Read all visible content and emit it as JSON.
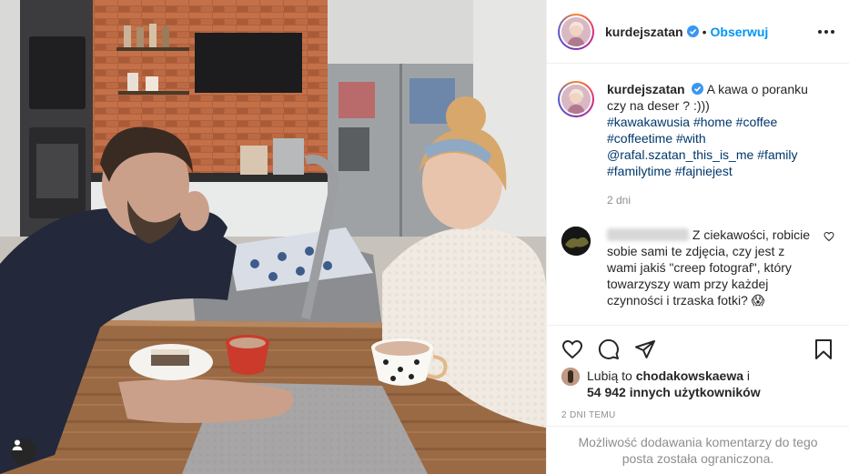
{
  "post": {
    "username": "kurdejszatan",
    "separator": "•",
    "follow_label": "Obserwuj"
  },
  "caption": {
    "username": "kurdejszatan",
    "text": "A kawa o poranku czy na deser ? :)))",
    "hashtags": [
      "#kawakawusia",
      "#home",
      "#coffee",
      "#coffeetime",
      "#with"
    ],
    "mention": "@rafal.szatan_this_is_me",
    "hashtags2": [
      "#family",
      "#familytime",
      "#fajniejest"
    ],
    "time": "2 dni"
  },
  "comment": {
    "text": "Z ciekawości, robicie sobie sami te zdjęcia, czy jest z wami jakiś \"creep fotograf\", który towarzyszy wam przy każdej czynności i trzaska fotki? 😱"
  },
  "likes": {
    "prefix": "Lubią to",
    "user": "chodakowskaewa",
    "conj": "i",
    "count": "54 942 innych użytkowników"
  },
  "posted_time": "2 DNI TEMU",
  "comments_restricted": "Możliwość dodawania komentarzy do tego posta została ograniczona.",
  "icons": {
    "verified": "verified-badge-icon",
    "like": "heart-icon",
    "comment": "comment-bubble-icon",
    "share": "paper-plane-icon",
    "save": "bookmark-icon",
    "tagged": "user-tag-icon",
    "more": "more-options-icon"
  },
  "colors": {
    "accent": "#0095f6",
    "verified": "#3897f0",
    "hashtag": "#00376b",
    "muted": "#8e8e8e"
  }
}
